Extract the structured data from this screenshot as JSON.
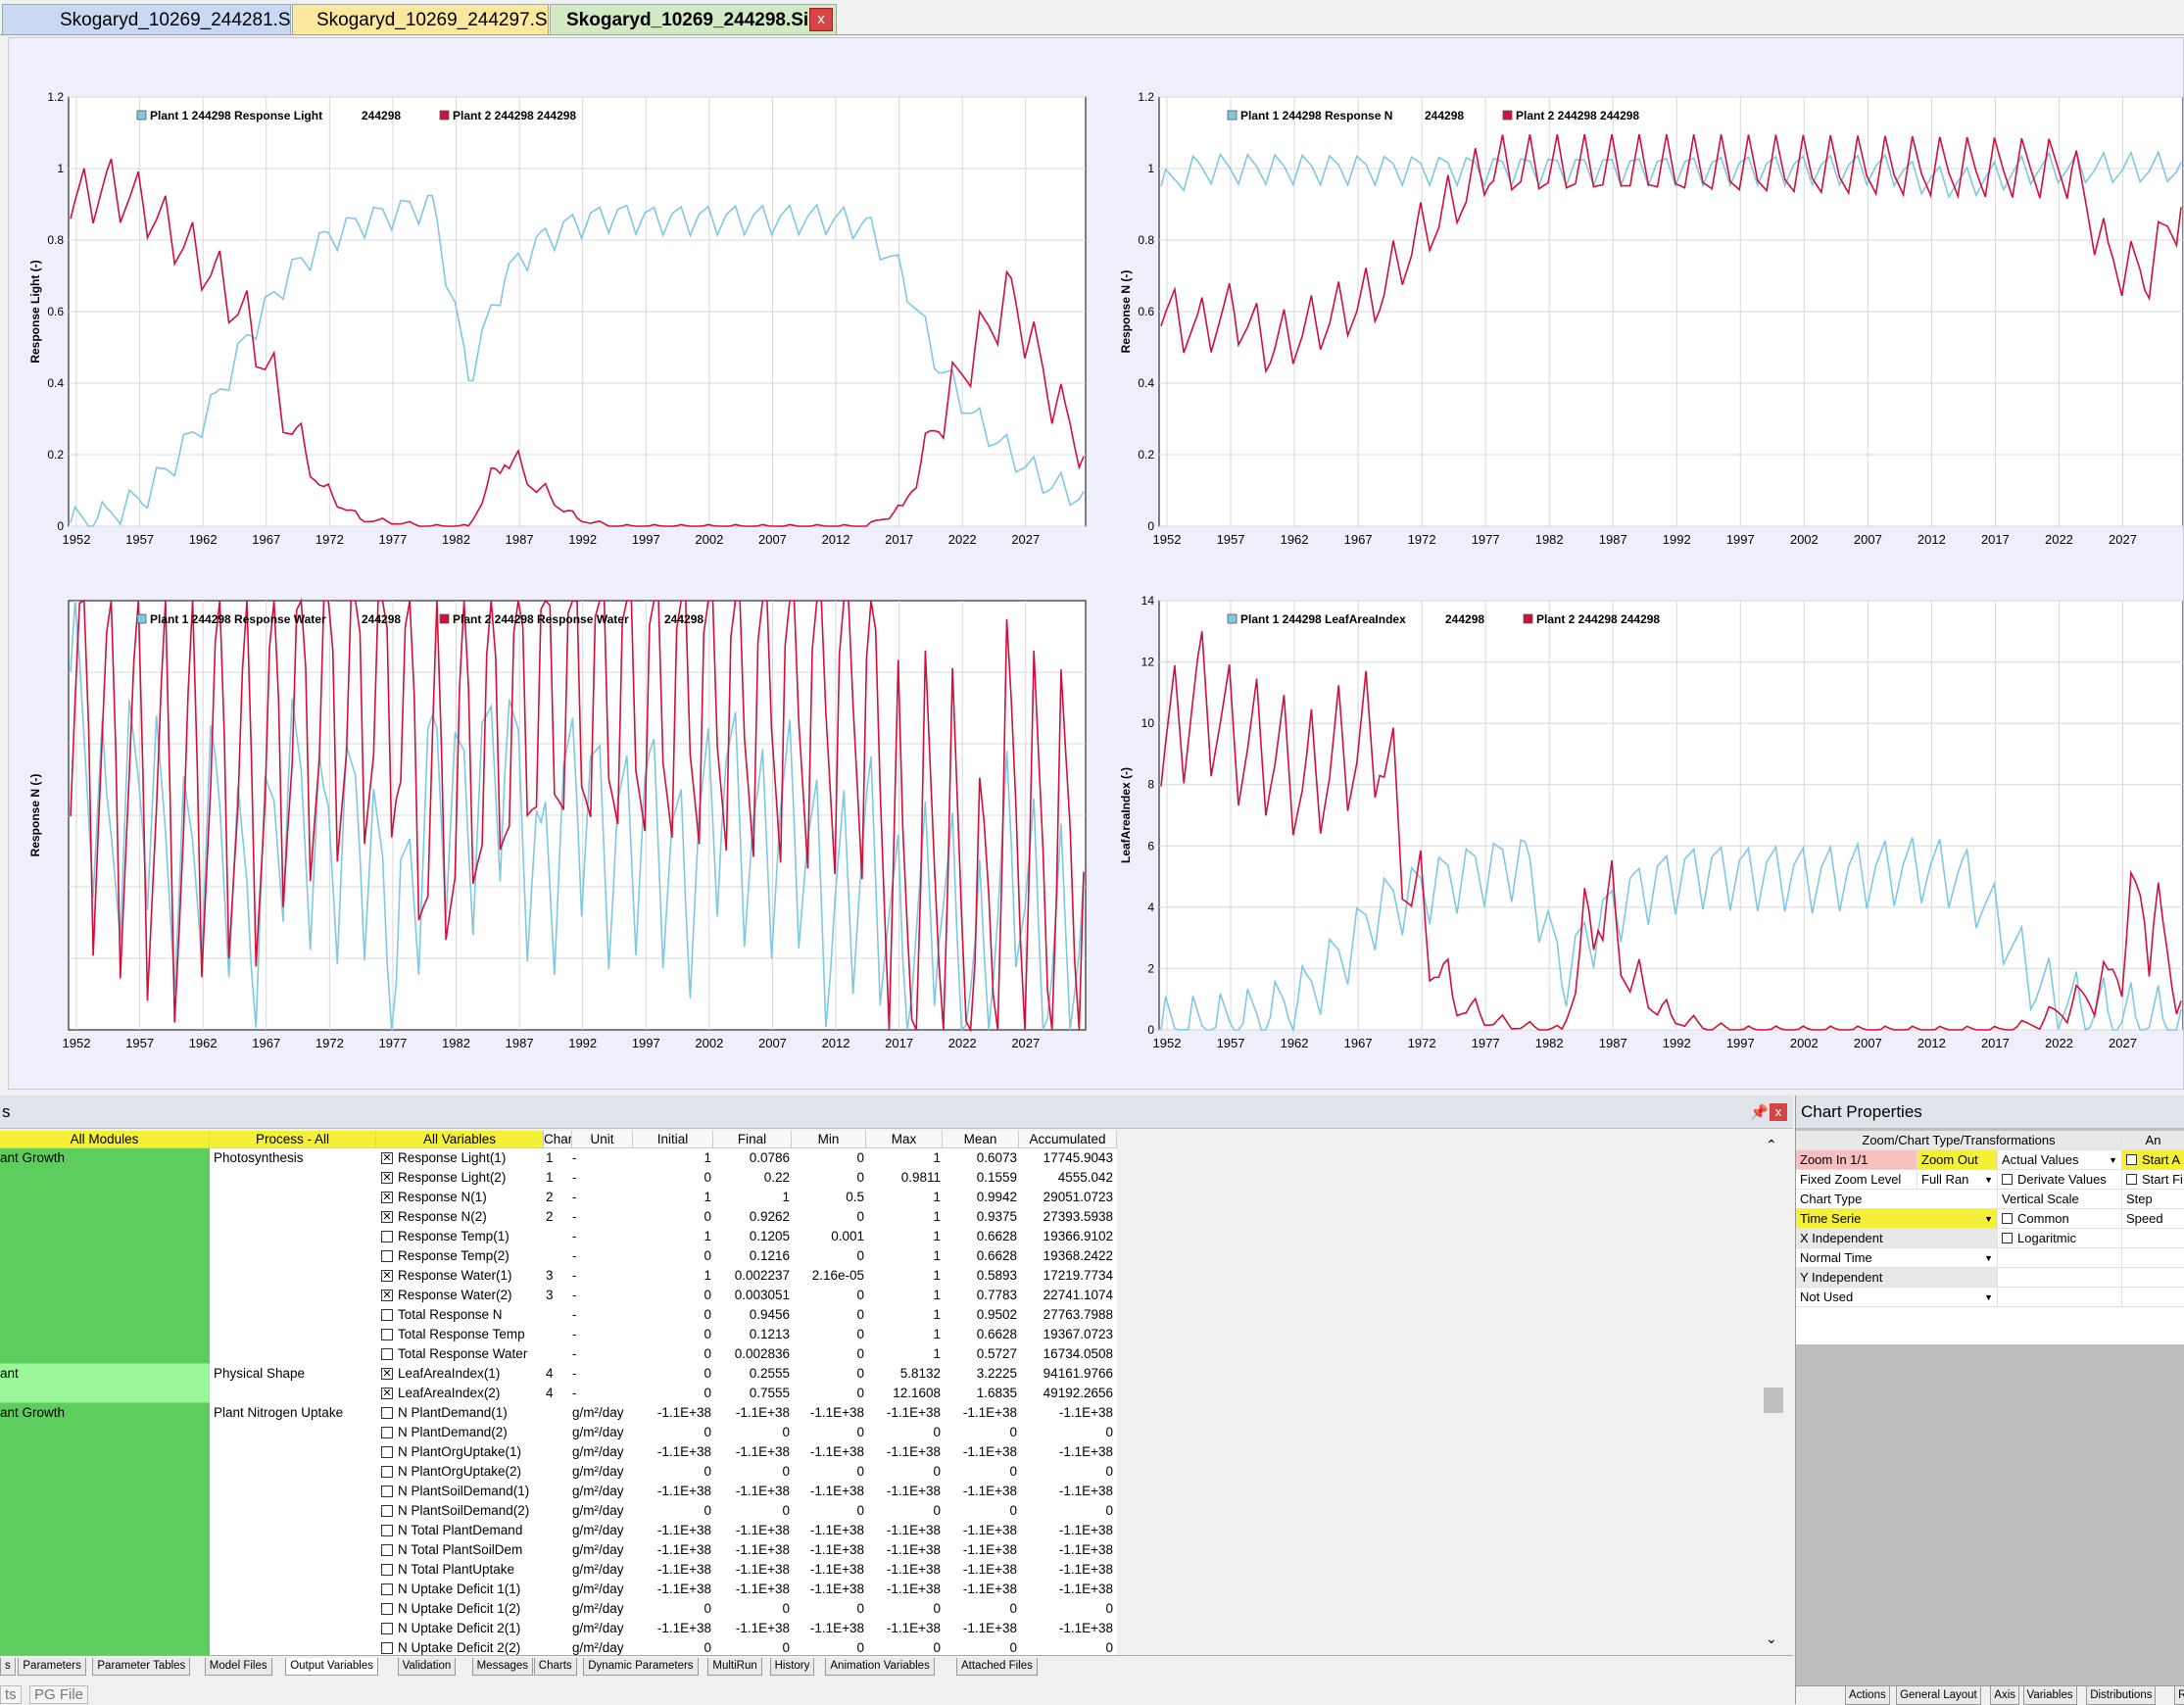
{
  "file_tabs": [
    {
      "label": "Skogaryd_10269_244281.Sim",
      "color": "#c9d8f3"
    },
    {
      "label": "Skogaryd_10269_244297.Sim",
      "color": "#fbe79d"
    },
    {
      "label": "Skogaryd_10269_244298.Sim",
      "color": "#d3e9c4",
      "active": true
    }
  ],
  "close_label": "x",
  "colors": {
    "series1": "#7ec8e3",
    "series2": "#d0103a",
    "chart_bg": "#efeffc"
  },
  "chart_data": [
    {
      "type": "line",
      "ylabel": "Response Light (-)",
      "ylim": [
        0,
        1.2
      ],
      "yticks": [
        "0",
        "0.2",
        "0.4",
        "0.6",
        "0.8",
        "1",
        "1.2"
      ],
      "xticks": [
        "1952",
        "1957",
        "1962",
        "1967",
        "1972",
        "1977",
        "1982",
        "1987",
        "1992",
        "1997",
        "2002",
        "2007",
        "2012",
        "2017",
        "2022",
        "2027"
      ],
      "legend": [
        {
          "name": "Plant 1 244298 Response Light",
          "id": "244298"
        },
        {
          "name": "Plant 2 244298 244298",
          "id": ""
        }
      ],
      "series": [
        {
          "name": "Plant 1",
          "values": [
            0.01,
            0.03,
            0.08,
            0.2,
            0.35,
            0.55,
            0.7,
            0.8,
            0.85,
            0.88,
            0.9,
            0.42,
            0.7,
            0.8,
            0.85,
            0.87,
            0.86,
            0.86,
            0.86,
            0.86,
            0.86,
            0.86,
            0.84,
            0.7,
            0.45,
            0.3,
            0.2,
            0.12,
            0.08
          ]
        },
        {
          "name": "Plant 2",
          "values": [
            0.9,
            0.95,
            0.9,
            0.8,
            0.7,
            0.55,
            0.3,
            0.1,
            0.02,
            0.01,
            0.0,
            0.0,
            0.2,
            0.1,
            0.02,
            0.0,
            0.0,
            0.0,
            0.0,
            0.0,
            0.0,
            0.0,
            0.0,
            0.05,
            0.3,
            0.5,
            0.65,
            0.4,
            0.2
          ]
        }
      ]
    },
    {
      "type": "line",
      "ylabel": "Response N (-)",
      "ylim": [
        0,
        1.2
      ],
      "yticks": [
        "0",
        "0.2",
        "0.4",
        "0.6",
        "0.8",
        "1",
        "1.2"
      ],
      "xticks": [
        "1952",
        "1957",
        "1962",
        "1967",
        "1972",
        "1977",
        "1982",
        "1987",
        "1992",
        "1997",
        "2002",
        "2007",
        "2012",
        "2017",
        "2022",
        "2027"
      ],
      "legend": [
        {
          "name": "Plant 1 244298 Response N",
          "id": "244298"
        },
        {
          "name": "Plant 2 244298 244298",
          "id": ""
        }
      ],
      "series": [
        {
          "name": "Plant 1",
          "values": [
            0.95,
            1,
            1,
            1,
            1,
            1,
            1,
            1,
            1,
            1,
            1,
            1,
            1,
            1,
            1,
            1,
            1,
            1,
            1,
            1,
            1,
            0.97,
            0.96,
            0.98,
            1,
            1,
            1,
            1,
            1
          ]
        },
        {
          "name": "Plant 2",
          "values": [
            0.6,
            0.55,
            0.6,
            0.5,
            0.55,
            0.6,
            0.65,
            0.8,
            0.9,
            1,
            1,
            1,
            1,
            1,
            1,
            1,
            1,
            1,
            1,
            1,
            1,
            1,
            1,
            1,
            1,
            1,
            0.75,
            0.7,
            0.9
          ]
        }
      ]
    },
    {
      "type": "line",
      "ylabel": "Response N (-)",
      "ylim": [
        0,
        1.2
      ],
      "yticks": [],
      "xticks": [
        "1952",
        "1957",
        "1962",
        "1967",
        "1972",
        "1977",
        "1982",
        "1987",
        "1992",
        "1997",
        "2002",
        "2007",
        "2012",
        "2017",
        "2022",
        "2027"
      ],
      "legend": [
        {
          "name": "Plant 1 244298 Response Water",
          "id": "244298"
        },
        {
          "name": "Plant 2 244298 Response Water",
          "id": "244298"
        }
      ],
      "series": [
        {
          "name": "Plant 1",
          "values": [
            1,
            0.5,
            0.7,
            0.4,
            0.6,
            0.3,
            0.7,
            0.5,
            0.6,
            0.2,
            0.7,
            0.6,
            0.8,
            0.4,
            0.7,
            0.5,
            0.6,
            0.4,
            0.7,
            0.5,
            0.6,
            0.3,
            0.5,
            0.2,
            0.4,
            0.1,
            0.5,
            0.2,
            0.3
          ]
        },
        {
          "name": "Plant 2",
          "values": [
            0.9,
            0.8,
            0.7,
            0.6,
            0.8,
            0.7,
            0.9,
            0.95,
            1,
            1,
            0.6,
            0.8,
            0.9,
            1,
            1,
            1,
            1,
            1,
            1,
            1,
            1,
            1,
            1,
            0.3,
            0.5,
            0.2,
            0.6,
            0.4,
            0.5
          ]
        }
      ]
    },
    {
      "type": "line",
      "ylabel": "LeafAreaIndex (-)",
      "ylim": [
        0,
        14
      ],
      "yticks": [
        "0",
        "2",
        "4",
        "6",
        "8",
        "10",
        "12",
        "14"
      ],
      "xticks": [
        "1952",
        "1957",
        "1962",
        "1967",
        "1972",
        "1977",
        "1982",
        "1987",
        "1992",
        "1997",
        "2002",
        "2007",
        "2012",
        "2017",
        "2022",
        "2027"
      ],
      "legend": [
        {
          "name": "Plant 1 244298 LeafAreaIndex",
          "id": "244298"
        },
        {
          "name": "Plant 2 244298 244298",
          "id": ""
        }
      ],
      "series": [
        {
          "name": "Plant 1",
          "values": [
            0.0,
            0.05,
            0.2,
            0.5,
            1.2,
            2.5,
            4.0,
            4.5,
            5.0,
            5.3,
            5.5,
            1.8,
            3.5,
            4.5,
            5.0,
            5.2,
            5.1,
            5.1,
            5.0,
            5.1,
            5.2,
            5.3,
            5.0,
            3.5,
            1.5,
            0.8,
            0.5,
            0.3,
            0.2
          ]
        },
        {
          "name": "Plant 2",
          "values": [
            9,
            11,
            9.5,
            9,
            8,
            9,
            9.5,
            4,
            1,
            0.3,
            0.1,
            0.0,
            4.5,
            1.5,
            0.4,
            0.1,
            0.0,
            0.0,
            0.0,
            0.0,
            0.0,
            0.0,
            0.0,
            0.0,
            0.2,
            0.8,
            1.5,
            4.5,
            1.0
          ]
        }
      ]
    }
  ],
  "bottom_panel": {
    "title_fragment": "s",
    "headers": {
      "modules": "All Modules",
      "process": "Process - All",
      "variables": "All Variables",
      "char": "Char",
      "unit": "Unit",
      "initial": "Initial",
      "final": "Final",
      "min": "Min",
      "max": "Max",
      "mean": "Mean",
      "accumulated": "Accumulated"
    },
    "groups": [
      {
        "module": "ant Growth",
        "process": "Photosynthesis",
        "color": "#5dcd5d",
        "rows": 11
      },
      {
        "module": "ant",
        "process": "Physical Shape",
        "color": "#99f799",
        "rows": 2
      },
      {
        "module": "ant Growth",
        "process": "Plant Nitrogen Uptake",
        "color": "#5dcd5d",
        "rows": 13
      }
    ],
    "rows": [
      {
        "checked": true,
        "name": "Response Light(1)",
        "char": "1",
        "unit": "-",
        "initial": "1",
        "final": "0.0786",
        "min": "0",
        "max": "1",
        "mean": "0.6073",
        "acc": "17745.9043"
      },
      {
        "checked": true,
        "name": "Response Light(2)",
        "char": "1",
        "unit": "-",
        "initial": "0",
        "final": "0.22",
        "min": "0",
        "max": "0.9811",
        "mean": "0.1559",
        "acc": "4555.042"
      },
      {
        "checked": true,
        "name": "Response N(1)",
        "char": "2",
        "unit": "-",
        "initial": "1",
        "final": "1",
        "min": "0.5",
        "max": "1",
        "mean": "0.9942",
        "acc": "29051.0723"
      },
      {
        "checked": true,
        "name": "Response N(2)",
        "char": "2",
        "unit": "-",
        "initial": "0",
        "final": "0.9262",
        "min": "0",
        "max": "1",
        "mean": "0.9375",
        "acc": "27393.5938"
      },
      {
        "checked": false,
        "name": "Response Temp(1)",
        "char": "",
        "unit": "-",
        "initial": "1",
        "final": "0.1205",
        "min": "0.001",
        "max": "1",
        "mean": "0.6628",
        "acc": "19366.9102"
      },
      {
        "checked": false,
        "name": "Response Temp(2)",
        "char": "",
        "unit": "-",
        "initial": "0",
        "final": "0.1216",
        "min": "0",
        "max": "1",
        "mean": "0.6628",
        "acc": "19368.2422"
      },
      {
        "checked": true,
        "name": "Response Water(1)",
        "char": "3",
        "unit": "-",
        "initial": "1",
        "final": "0.002237",
        "min": "2.16e-05",
        "max": "1",
        "mean": "0.5893",
        "acc": "17219.7734"
      },
      {
        "checked": true,
        "name": "Response Water(2)",
        "char": "3",
        "unit": "-",
        "initial": "0",
        "final": "0.003051",
        "min": "0",
        "max": "1",
        "mean": "0.7783",
        "acc": "22741.1074"
      },
      {
        "checked": false,
        "name": "Total Response N",
        "char": "",
        "unit": "-",
        "initial": "0",
        "final": "0.9456",
        "min": "0",
        "max": "1",
        "mean": "0.9502",
        "acc": "27763.7988"
      },
      {
        "checked": false,
        "name": "Total Response Temp",
        "char": "",
        "unit": "-",
        "initial": "0",
        "final": "0.1213",
        "min": "0",
        "max": "1",
        "mean": "0.6628",
        "acc": "19367.0723"
      },
      {
        "checked": false,
        "name": "Total Response Water",
        "char": "",
        "unit": "-",
        "initial": "0",
        "final": "0.002836",
        "min": "0",
        "max": "1",
        "mean": "0.5727",
        "acc": "16734.0508"
      },
      {
        "checked": true,
        "name": "LeafAreaIndex(1)",
        "char": "4",
        "unit": "-",
        "initial": "0",
        "final": "0.2555",
        "min": "0",
        "max": "5.8132",
        "mean": "3.2225",
        "acc": "94161.9766"
      },
      {
        "checked": true,
        "name": "LeafAreaIndex(2)",
        "char": "4",
        "unit": "-",
        "initial": "0",
        "final": "0.7555",
        "min": "0",
        "max": "12.1608",
        "mean": "1.6835",
        "acc": "49192.2656"
      },
      {
        "checked": false,
        "name": "N  PlantDemand(1)",
        "char": "",
        "unit": "g/m²/day",
        "initial": "-1.1E+38",
        "final": "-1.1E+38",
        "min": "-1.1E+38",
        "max": "-1.1E+38",
        "mean": "-1.1E+38",
        "acc": "-1.1E+38"
      },
      {
        "checked": false,
        "name": "N  PlantDemand(2)",
        "char": "",
        "unit": "g/m²/day",
        "initial": "0",
        "final": "0",
        "min": "0",
        "max": "0",
        "mean": "0",
        "acc": "0"
      },
      {
        "checked": false,
        "name": "N  PlantOrgUptake(1)",
        "char": "",
        "unit": "g/m²/day",
        "initial": "-1.1E+38",
        "final": "-1.1E+38",
        "min": "-1.1E+38",
        "max": "-1.1E+38",
        "mean": "-1.1E+38",
        "acc": "-1.1E+38"
      },
      {
        "checked": false,
        "name": "N  PlantOrgUptake(2)",
        "char": "",
        "unit": "g/m²/day",
        "initial": "0",
        "final": "0",
        "min": "0",
        "max": "0",
        "mean": "0",
        "acc": "0"
      },
      {
        "checked": false,
        "name": "N  PlantSoilDemand(1)",
        "char": "",
        "unit": "g/m²/day",
        "initial": "-1.1E+38",
        "final": "-1.1E+38",
        "min": "-1.1E+38",
        "max": "-1.1E+38",
        "mean": "-1.1E+38",
        "acc": "-1.1E+38"
      },
      {
        "checked": false,
        "name": "N  PlantSoilDemand(2)",
        "char": "",
        "unit": "g/m²/day",
        "initial": "0",
        "final": "0",
        "min": "0",
        "max": "0",
        "mean": "0",
        "acc": "0"
      },
      {
        "checked": false,
        "name": "N  Total PlantDemand",
        "char": "",
        "unit": "g/m²/day",
        "initial": "-1.1E+38",
        "final": "-1.1E+38",
        "min": "-1.1E+38",
        "max": "-1.1E+38",
        "mean": "-1.1E+38",
        "acc": "-1.1E+38"
      },
      {
        "checked": false,
        "name": "N  Total PlantSoilDem",
        "char": "",
        "unit": "g/m²/day",
        "initial": "-1.1E+38",
        "final": "-1.1E+38",
        "min": "-1.1E+38",
        "max": "-1.1E+38",
        "mean": "-1.1E+38",
        "acc": "-1.1E+38"
      },
      {
        "checked": false,
        "name": "N  Total PlantUptake",
        "char": "",
        "unit": "g/m²/day",
        "initial": "-1.1E+38",
        "final": "-1.1E+38",
        "min": "-1.1E+38",
        "max": "-1.1E+38",
        "mean": "-1.1E+38",
        "acc": "-1.1E+38"
      },
      {
        "checked": false,
        "name": "N  Uptake Deficit 1(1)",
        "char": "",
        "unit": "g/m²/day",
        "initial": "-1.1E+38",
        "final": "-1.1E+38",
        "min": "-1.1E+38",
        "max": "-1.1E+38",
        "mean": "-1.1E+38",
        "acc": "-1.1E+38"
      },
      {
        "checked": false,
        "name": "N  Uptake Deficit 1(2)",
        "char": "",
        "unit": "g/m²/day",
        "initial": "0",
        "final": "0",
        "min": "0",
        "max": "0",
        "mean": "0",
        "acc": "0"
      },
      {
        "checked": false,
        "name": "N  Uptake Deficit 2(1)",
        "char": "",
        "unit": "g/m²/day",
        "initial": "-1.1E+38",
        "final": "-1.1E+38",
        "min": "-1.1E+38",
        "max": "-1.1E+38",
        "mean": "-1.1E+38",
        "acc": "-1.1E+38"
      },
      {
        "checked": false,
        "name": "N  Uptake Deficit 2(2)",
        "char": "",
        "unit": "g/m²/day",
        "initial": "0",
        "final": "0",
        "min": "0",
        "max": "0",
        "mean": "0",
        "acc": "0"
      }
    ],
    "tabs": [
      "s",
      "Parameters",
      "Parameter Tables",
      "Model Files",
      "Output Variables",
      "Validation",
      "Messages",
      "Charts",
      "Dynamic Parameters",
      "MultiRun",
      "History",
      "Animation Variables",
      "Attached Files"
    ],
    "active_tab": "Output Variables",
    "tabs2": [
      "ts",
      "PG File"
    ]
  },
  "chart_properties": {
    "title": "Chart Properties",
    "section_header": "Zoom/Chart Type/Transformations",
    "section_header_right": "An",
    "zoom_in": "Zoom In 1/1",
    "zoom_out": "Zoom Out",
    "actual_values": "Actual Values",
    "start_a": "Start A",
    "fixed_zoom": "Fixed Zoom Level",
    "full_range": "Full Ran",
    "derivate_values": "Derivate Values",
    "start_f": "Start Fi",
    "chart_type_label": "Chart Type",
    "vertical_scale": "Vertical Scale",
    "step": "Step",
    "time_serie": "Time Serie",
    "common": "Common",
    "speed": "Speed",
    "x_independent": "X Independent",
    "logaritmic": "Logaritmic",
    "normal_time": "Normal Time",
    "y_independent": "Y Independent",
    "not_used": "Not Used",
    "tabs": [
      "Actions",
      "General Layout",
      "Axis",
      "Variables",
      "Distributions",
      "Regress"
    ]
  }
}
